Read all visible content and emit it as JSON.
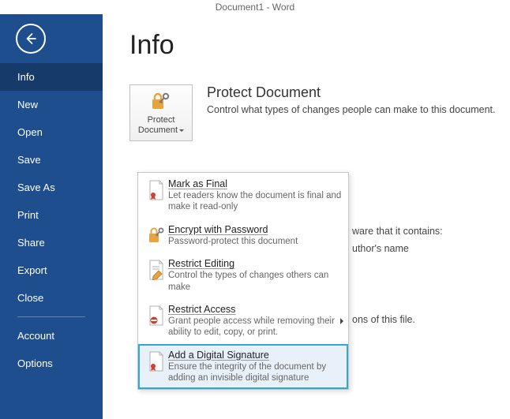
{
  "title_bar": "Document1 - Word",
  "page_heading": "Info",
  "sidebar": {
    "items": [
      {
        "label": "Info",
        "active": true
      },
      {
        "label": "New"
      },
      {
        "label": "Open"
      },
      {
        "label": "Save"
      },
      {
        "label": "Save As"
      },
      {
        "label": "Print"
      },
      {
        "label": "Share"
      },
      {
        "label": "Export"
      },
      {
        "label": "Close"
      }
    ],
    "footer_items": [
      {
        "label": "Account"
      },
      {
        "label": "Options"
      }
    ]
  },
  "protect": {
    "button_label": "Protect Document",
    "heading": "Protect Document",
    "description": "Control what types of changes people can make to this document."
  },
  "background_fragments": {
    "frag1": "ware that it contains:",
    "frag2": "uthor's name",
    "frag3": "ons of this file."
  },
  "dropdown": {
    "items": [
      {
        "title": "Mark as Final",
        "desc": "Let readers know the document is final and make it read-only",
        "selected": false,
        "submenu": false
      },
      {
        "title": "Encrypt with Password",
        "desc": "Password-protect this document",
        "selected": false,
        "submenu": false
      },
      {
        "title": "Restrict Editing",
        "desc": "Control the types of changes others can make",
        "selected": false,
        "submenu": false
      },
      {
        "title": "Restrict Access",
        "desc": "Grant people access while removing their ability to edit, copy, or print.",
        "selected": false,
        "submenu": true
      },
      {
        "title": "Add a Digital Signature",
        "desc": "Ensure the integrity of the document by adding an invisible digital signature",
        "selected": true,
        "submenu": false
      }
    ]
  }
}
